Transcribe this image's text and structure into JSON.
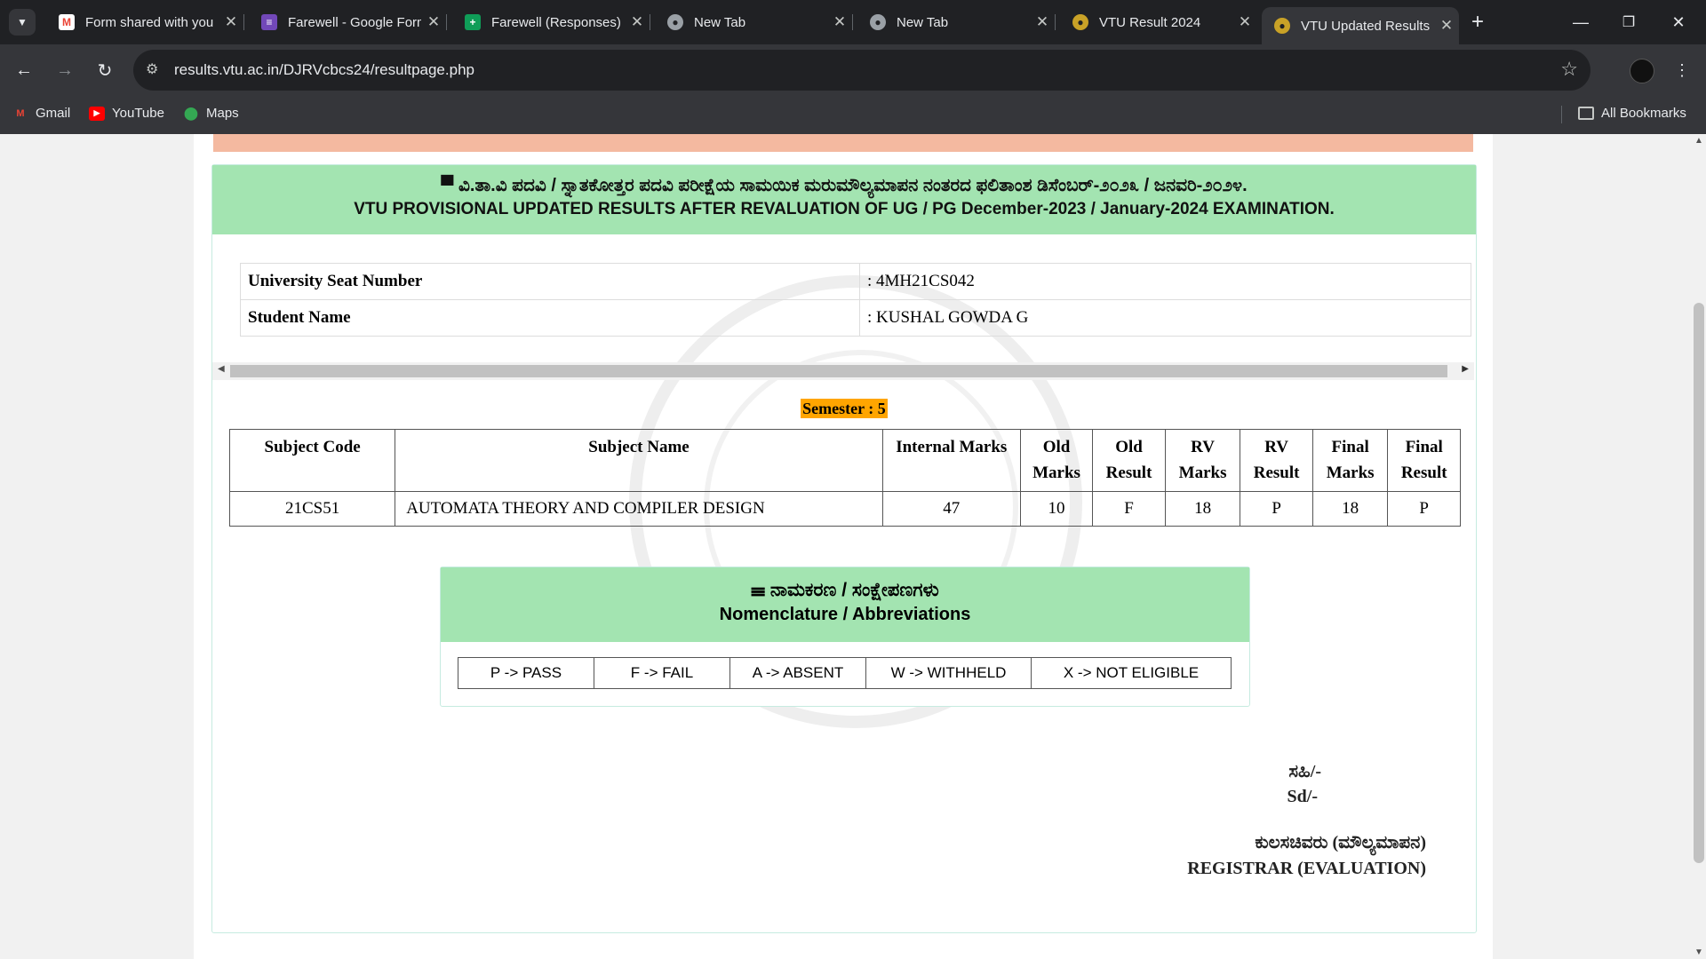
{
  "browser": {
    "tabs": [
      {
        "title": "Form shared with you",
        "icon": "gmail-icon"
      },
      {
        "title": "Farewell - Google Forms",
        "icon": "forms-icon"
      },
      {
        "title": "Farewell (Responses)",
        "icon": "sheets-icon"
      },
      {
        "title": "New Tab",
        "icon": "chrome-icon"
      },
      {
        "title": "New Tab",
        "icon": "chrome-icon"
      },
      {
        "title": "VTU Result 2024",
        "icon": "vtu-icon"
      },
      {
        "title": "VTU Updated Results",
        "icon": "vtu-icon"
      }
    ],
    "url": "results.vtu.ac.in/DJRVcbcs24/resultpage.php",
    "bookmarks": [
      {
        "label": "Gmail"
      },
      {
        "label": "YouTube"
      },
      {
        "label": "Maps"
      }
    ],
    "all_bookmarks": "All Bookmarks"
  },
  "page": {
    "header_kannada": "ವಿ.ತಾ.ವಿ ಪದವಿ / ಸ್ನಾತಕೋತ್ತರ ಪದವಿ ಪರೀಕ್ಷೆಯ ಸಾಮಯಿಕ ಮರುಮೌಲ್ಯಮಾಪನ ನಂತರದ ಫಲಿತಾಂಶ ಡಿಸೆಂಬರ್-೨೦೨೩ / ಜನವರಿ-೨೦೨೪.",
    "header_english": "VTU PROVISIONAL UPDATED RESULTS AFTER REVALUATION OF UG / PG December-2023 / January-2024 EXAMINATION.",
    "student": {
      "usn_label": "University Seat Number",
      "usn_value": ": 4MH21CS042",
      "name_label": "Student Name",
      "name_value": ": KUSHAL GOWDA G"
    },
    "semester": "Semester : 5",
    "marks_table": {
      "headers": [
        "Subject Code",
        "Subject Name",
        "Internal Marks",
        "Old Marks",
        "Old Result",
        "RV Marks",
        "RV Result",
        "Final Marks",
        "Final Result"
      ],
      "rows": [
        [
          "21CS51",
          "AUTOMATA THEORY AND COMPILER DESIGN",
          "47",
          "10",
          "F",
          "18",
          "P",
          "18",
          "P"
        ]
      ]
    },
    "nomenclature": {
      "title_kannada": "ನಾಮಕರಣ / ಸಂಕ್ಷೇಪಣಗಳು",
      "title_english": "Nomenclature / Abbreviations",
      "items": [
        "P -> PASS",
        "F -> FAIL",
        "A -> ABSENT",
        "W -> WITHHELD",
        "X -> NOT ELIGIBLE"
      ]
    },
    "signature": {
      "sd_kannada": "ಸಹಿ/-",
      "sd_english": "Sd/-",
      "role_kannada": "ಕುಲಸಚಿವರು (ಮೌಲ್ಯಮಾಪನ)",
      "role_english": "REGISTRAR (EVALUATION)"
    }
  }
}
